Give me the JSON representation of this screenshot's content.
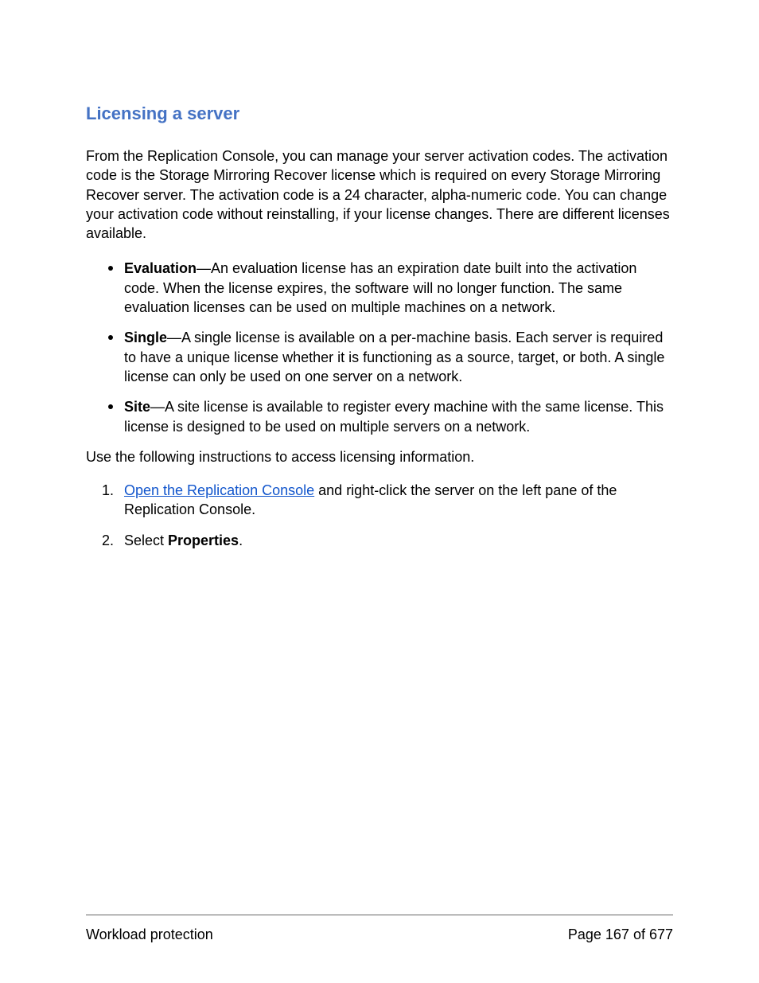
{
  "heading": "Licensing a server",
  "intro": "From the Replication Console, you can manage your server activation codes.  The activation code is the Storage Mirroring Recover license which is required on every Storage Mirroring Recover server. The activation code is a 24 character, alpha-numeric code. You can change your activation code without reinstalling, if your license changes. There are different licenses available.",
  "bullets": [
    {
      "term": "Evaluation",
      "text": "—An evaluation license has an expiration date built into the activation code. When the license expires, the software will no longer function. The same evaluation licenses can be used on multiple machines on a network."
    },
    {
      "term": "Single",
      "text": "—A single license is available on a per-machine basis. Each server is required to have a unique license whether it is functioning as a source, target, or both. A single license can only be used on one server on a network."
    },
    {
      "term": "Site",
      "text": "—A site license is available to register every machine with the same license. This license is designed to be used on multiple servers on a network."
    }
  ],
  "instructionsIntro": "Use the following instructions to access licensing information.",
  "steps": {
    "step1": {
      "link": "Open the Replication Console",
      "after": " and right-click the server on the left pane of the Replication Console."
    },
    "step2": {
      "prefix": "Select ",
      "bold": "Properties",
      "suffix": "."
    }
  },
  "footer": {
    "left": "Workload protection",
    "right": "Page 167 of 677"
  }
}
